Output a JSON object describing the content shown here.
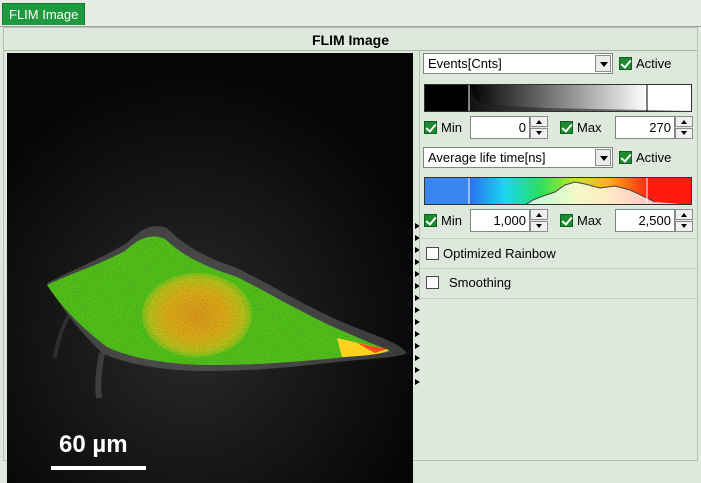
{
  "tab": {
    "label": "FLIM Image"
  },
  "panel": {
    "title": "FLIM Image"
  },
  "image": {
    "scale_label": "60 µm"
  },
  "events": {
    "combo_value": "Events[Cnts]",
    "active_label": "Active",
    "min_label": "Min",
    "min_value": "0",
    "max_label": "Max",
    "max_value": "270"
  },
  "lifetime": {
    "combo_value": "Average life time[ns]",
    "active_label": "Active",
    "min_label": "Min",
    "min_value": "1,000",
    "max_label": "Max",
    "max_value": "2,500"
  },
  "options": {
    "optimized_rainbow_label": "Optimized Rainbow",
    "smoothing_label": "Smoothing"
  },
  "colors": {
    "tab": "#1f9a3e",
    "checkbox": "#1c8a2f",
    "background": "#dfe8dc"
  }
}
